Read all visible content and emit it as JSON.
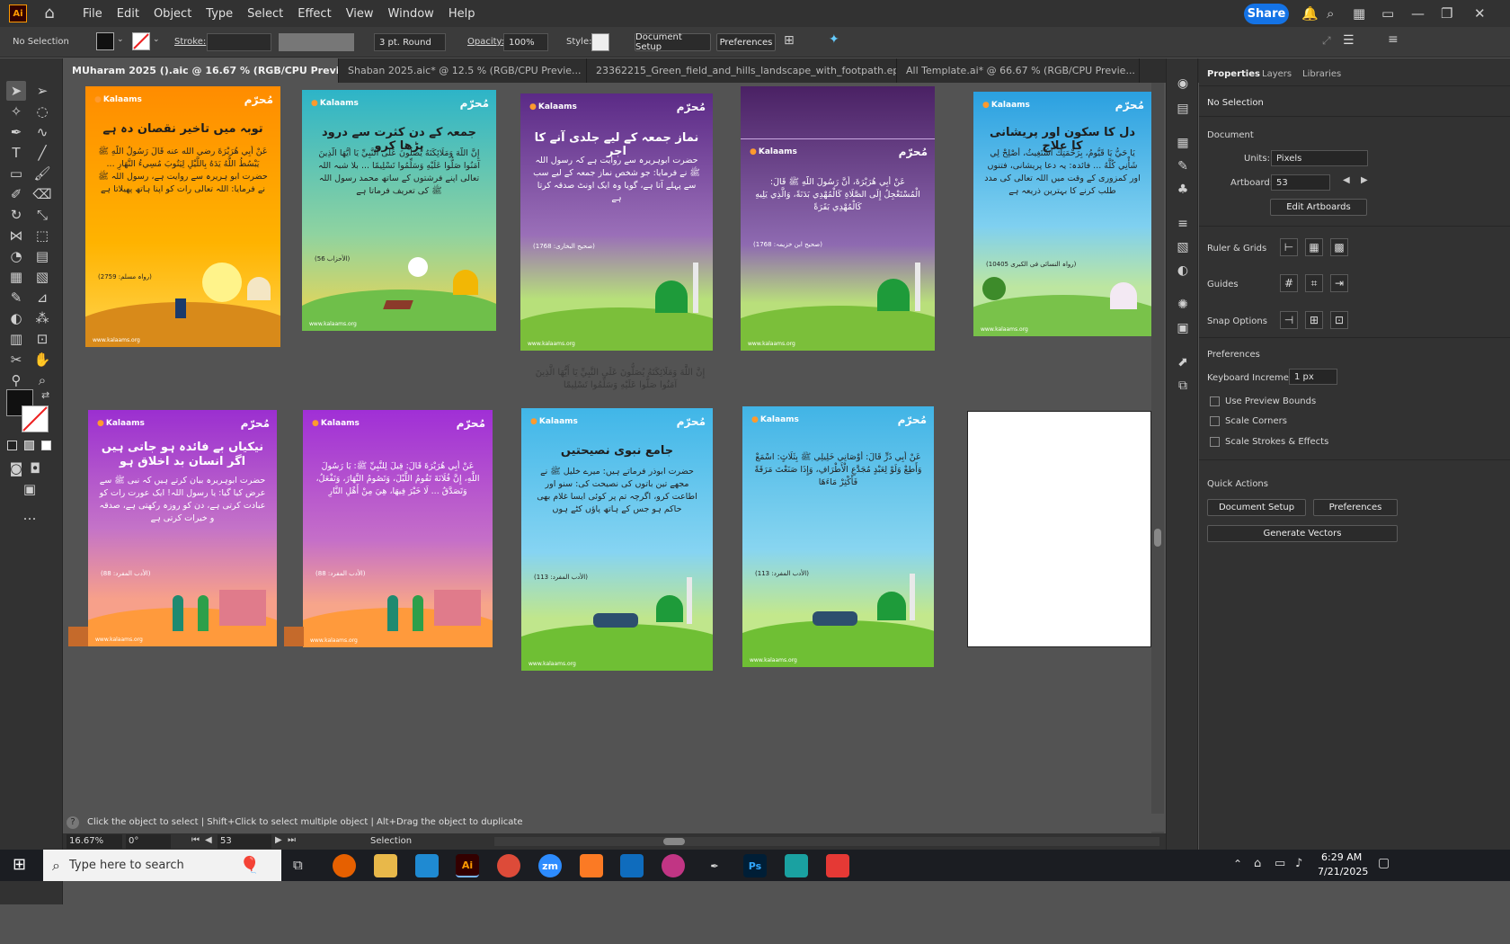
{
  "menubar": {
    "app_icon": "Ai",
    "menus": [
      "File",
      "Edit",
      "Object",
      "Type",
      "Select",
      "Effect",
      "View",
      "Window",
      "Help"
    ],
    "share": "Share"
  },
  "control": {
    "selection": "No Selection",
    "stroke_label": "Stroke:",
    "brush": "3 pt. Round",
    "opacity_label": "Opacity:",
    "opacity_value": "100%",
    "style_label": "Style:",
    "document_setup": "Document Setup",
    "preferences": "Preferences"
  },
  "tabs": [
    {
      "label": "MUharam 2025 ().aic @ 16.67 % (RGB/CPU Preview)",
      "close": "×"
    },
    {
      "label": "Shaban 2025.aic* @ 12.5 % (RGB/CPU Previe...",
      "close": "×"
    },
    {
      "label": "23362215_Green_field_and_hills_landscape_with_footpath.eps*...",
      "close": "×"
    },
    {
      "label": "All Template.ai* @ 66.67 % (RGB/CPU Previe...",
      "close": "×"
    }
  ],
  "artboards": [
    {
      "logo": "Kalaams",
      "brand": "مُحرّم",
      "title": "توبہ میں تاخیر نقصان دہ ہے",
      "body": "عَنْ أَبِي هُرَيْرَةَ رضي الله عنه قَالَ رَسُولُ اللَّهِ ﷺ يَبْسُطُ اللَّهُ يَدَهُ بِاللَّيْلِ لِيَتُوبَ مُسِيءُ النَّهَارِ ... حضرت ابو ہریرہ سے روایت ہے، رسول اللہ ﷺ نے فرمایا: اللہ تعالی رات کو اپنا ہاتھ پھیلاتا ہے",
      "ref": "(رواہ مسلم: 2759)",
      "site": "www.kalaams.org"
    },
    {
      "logo": "Kalaams",
      "brand": "مُحرّم",
      "title": "جمعہ کے دن کثرت سے درود پڑھا کرو",
      "body": "إِنَّ اللَّهَ وَمَلَائِكَتَهُ يُصَلُّونَ عَلَى النَّبِيِّ يَا أَيُّهَا الَّذِينَ آمَنُوا صَلُّوا عَلَيْهِ وَسَلِّمُوا تَسْلِيمًا ... بلا شبہ اللہ تعالی اپنے فرشتوں کے ساتھ محمد رسول اللہ ﷺ کی تعریف فرماتا ہے",
      "ref": "(الأحزاب 56)",
      "site": "www.kalaams.org"
    },
    {
      "logo": "Kalaams",
      "brand": "مُحرّم",
      "title": "نماز جمعہ کے لیے جلدی آنے کا اجر",
      "body": "حضرت ابوہریرہ سے روایت ہے کہ رسول اللہ ﷺ نے فرمایا: جو شخص نماز جمعہ کے لیے سب سے پہلے آتا ہے، گویا وہ ایک اونٹ صدقہ کرتا ہے",
      "ref": "(صحیح البخاری: 1768)",
      "site": "www.kalaams.org"
    },
    {
      "logo": "Kalaams",
      "brand": "مُحرّم",
      "title": "",
      "body": "عَنْ أَبِي هُرَيْرَةَ، أَنَّ رَسُولَ اللَّهِ ﷺ قَالَ: الْمُسْتَعْجِلُ إِلَى الصَّلَاةِ كَالْمُهْدِي بَدَنَةً، وَالَّذِي يَلِيهِ كَالْمُهْدِي بَقَرَةً",
      "ref": "(صحیح ابن خزیمہ: 1768)",
      "site": "www.kalaams.org"
    },
    {
      "logo": "Kalaams",
      "brand": "مُحرّم",
      "title": "دل کا سکون اور پریشانی کا علاج",
      "body": "يَا حَيُّ يَا قَيُّومُ، بِرَحْمَتِكَ أَسْتَغِيثُ، أَصْلِحْ لِي شَأْنِي كُلَّهُ ... فائدہ: یہ دعا پریشانی، فتنوں اور کمزوری کے وقت میں اللہ تعالی کی مدد طلب کرنے کا بہترین ذریعہ ہے",
      "ref": "(رواہ النسائی فی الکبری 10405)",
      "site": "www.kalaams.org"
    },
    {
      "logo": "Kalaams",
      "brand": "مُحرّم",
      "title": "نیکیاں بے فائدہ ہو جاتی ہیں اگر انسان بد اخلاق ہو",
      "body": "حضرت ابوہریرہ بیان کرتے ہیں کہ نبی ﷺ سے عرض کیا گیا: یا رسول اللہ! ایک عورت رات کو عبادت کرتی ہے، دن کو روزہ رکھتی ہے، صدقہ و خیرات کرتی ہے",
      "ref": "(الأدب المفرد: 88)",
      "site": "www.kalaams.org"
    },
    {
      "logo": "Kalaams",
      "brand": "مُحرّم",
      "title": "",
      "body": "عَنْ أَبِي هُرَيْرَةَ قَالَ: قِيلَ لِلنَّبِيِّ ﷺ: يَا رَسُولَ اللَّهِ، إِنَّ فُلَانَةَ تَقُومُ اللَّيْلَ، وَتَصُومُ النَّهَارَ، وَتَفْعَلُ، وَتَصَدَّقُ ... لَا خَيْرَ فِيهَا، هِيَ مِنْ أَهْلِ النَّارِ",
      "ref": "(الأدب المفرد: 88)",
      "site": "www.kalaams.org"
    },
    {
      "logo": "Kalaams",
      "brand": "مُحرّم",
      "title": "جامع نبوی نصیحتیں",
      "body": "حضرت ابوذر فرماتے ہیں: میرے خلیل ﷺ نے مجھے تین باتوں کی نصیحت کی: سنو اور اطاعت کرو، اگرچہ تم پر کوئی ایسا غلام بھی حاکم ہو جس کے ہاتھ پاؤں کٹے ہوں",
      "ref": "(الأدب المفرد: 113)",
      "site": "www.kalaams.org"
    },
    {
      "logo": "Kalaams",
      "brand": "مُحرّم",
      "title": "",
      "body": "عَنْ أَبِي ذَرٍّ قَالَ: أَوْصَانِي خَلِيلِي ﷺ بِثَلَاثٍ: اسْمَعْ وَأَطِعْ وَلَوْ لِعَبْدٍ مُجَدَّعِ الْأَطْرَافِ، وَإِذَا صَنَعْتَ مَرَقَةً فَأَكْثِرْ مَاءَهَا",
      "ref": "(الأدب المفرد: 113)",
      "site": "www.kalaams.org"
    }
  ],
  "canvas_snippet": "إِنَّ اللَّهَ وَمَلَائِكَتَهُ يُصَلُّونَ عَلَى النَّبِيِّ يَا أَيُّهَا الَّذِينَ آمَنُوا صَلُّوا عَلَيْهِ وَسَلِّمُوا تَسْلِيمًا",
  "status": {
    "hint": "Click the object to select  |  Shift+Click to select multiple object  |  Alt+Drag the object to duplicate",
    "zoom": "16.67%",
    "rotation": "0°",
    "artboard_num": "53",
    "mode": "Selection"
  },
  "properties": {
    "tabs": [
      "Properties",
      "Layers",
      "Libraries"
    ],
    "selection": "No Selection",
    "document": "Document",
    "units_label": "Units:",
    "units": "Pixels",
    "artboard_label": "Artboard:",
    "artboard": "53",
    "edit_artboards": "Edit Artboards",
    "rulers_grids": "Ruler & Grids",
    "guides": "Guides",
    "snap_options": "Snap Options",
    "preferences_header": "Preferences",
    "keyboard_increment_label": "Keyboard Increment:",
    "keyboard_increment": "1 px",
    "use_preview_bounds": "Use Preview Bounds",
    "scale_corners": "Scale Corners",
    "scale_strokes": "Scale Strokes & Effects",
    "quick_actions": "Quick Actions",
    "document_setup": "Document Setup",
    "preferences": "Preferences",
    "generate_vectors": "Generate Vectors"
  },
  "taskbar": {
    "search_placeholder": "Type here to search",
    "time": "6:29 AM",
    "date": "7/21/2025",
    "apps": [
      "zm",
      "Ai",
      "Ps"
    ]
  }
}
